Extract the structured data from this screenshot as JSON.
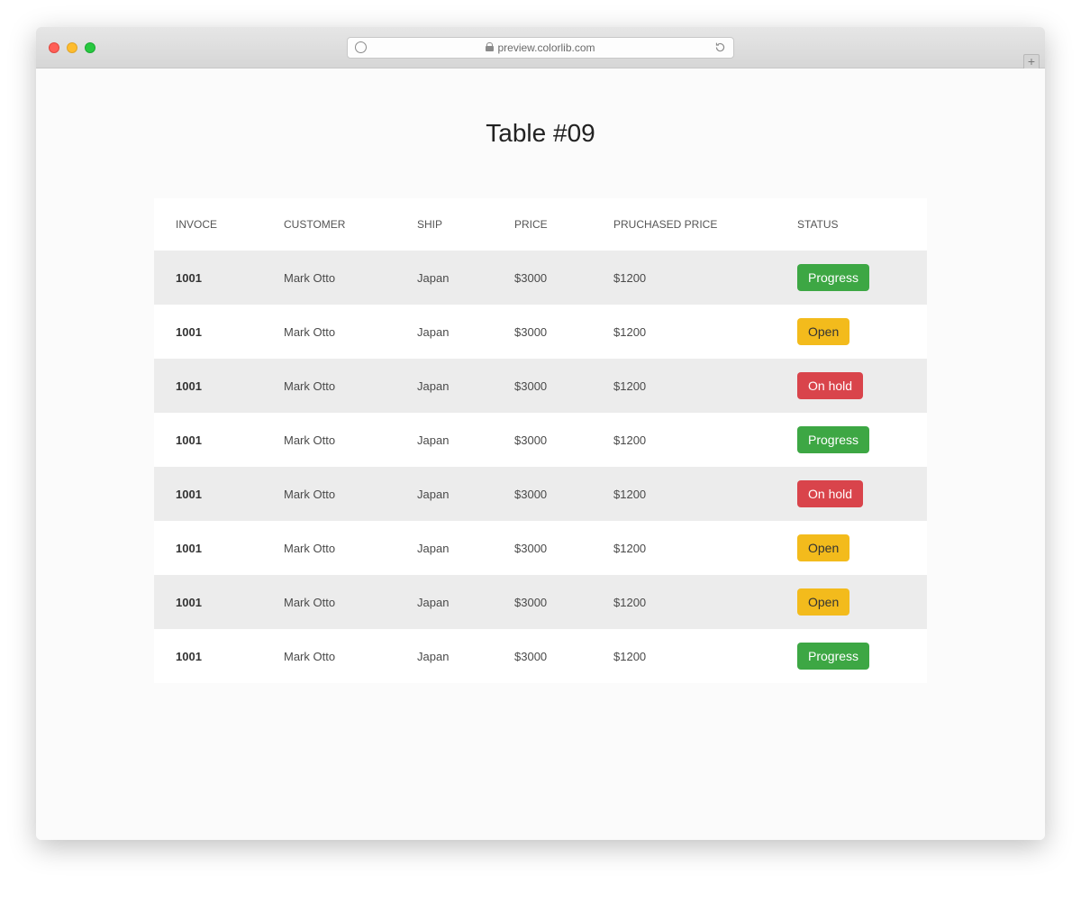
{
  "browser": {
    "url_display": "preview.colorlib.com"
  },
  "page": {
    "title": "Table #09"
  },
  "status_colors": {
    "Progress": "#3da744",
    "Open": "#f3bb1c",
    "On hold": "#d9444b"
  },
  "table": {
    "headers": [
      "INVOCE",
      "CUSTOMER",
      "SHIP",
      "PRICE",
      "PRUCHASED PRICE",
      "STATUS"
    ],
    "rows": [
      {
        "invoice": "1001",
        "customer": "Mark Otto",
        "ship": "Japan",
        "price": "$3000",
        "purchased_price": "$1200",
        "status": "Progress"
      },
      {
        "invoice": "1001",
        "customer": "Mark Otto",
        "ship": "Japan",
        "price": "$3000",
        "purchased_price": "$1200",
        "status": "Open"
      },
      {
        "invoice": "1001",
        "customer": "Mark Otto",
        "ship": "Japan",
        "price": "$3000",
        "purchased_price": "$1200",
        "status": "On hold"
      },
      {
        "invoice": "1001",
        "customer": "Mark Otto",
        "ship": "Japan",
        "price": "$3000",
        "purchased_price": "$1200",
        "status": "Progress"
      },
      {
        "invoice": "1001",
        "customer": "Mark Otto",
        "ship": "Japan",
        "price": "$3000",
        "purchased_price": "$1200",
        "status": "On hold"
      },
      {
        "invoice": "1001",
        "customer": "Mark Otto",
        "ship": "Japan",
        "price": "$3000",
        "purchased_price": "$1200",
        "status": "Open"
      },
      {
        "invoice": "1001",
        "customer": "Mark Otto",
        "ship": "Japan",
        "price": "$3000",
        "purchased_price": "$1200",
        "status": "Open"
      },
      {
        "invoice": "1001",
        "customer": "Mark Otto",
        "ship": "Japan",
        "price": "$3000",
        "purchased_price": "$1200",
        "status": "Progress"
      }
    ]
  }
}
